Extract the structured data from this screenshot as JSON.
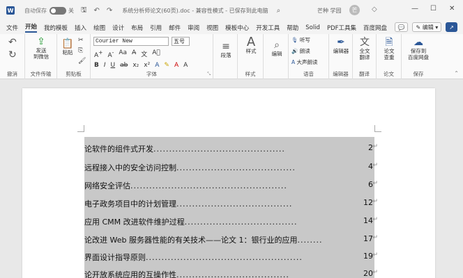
{
  "titlebar": {
    "app_icon": "W",
    "autosave_label": "自动保存",
    "autosave_state": "关",
    "doc_title": "系统分析师论文(60页).doc - 兼容性模式 - 已保存到此电脑",
    "user_name": "芒种 学园",
    "avatar_text": "芒",
    "search_icon": "search-icon",
    "undo_icon": "undo-icon",
    "redo_icon": "redo-icon",
    "save_icon": "save-icon",
    "premium_icon": "diamond-icon",
    "minimize": "—",
    "maximize": "☐",
    "close": "✕"
  },
  "menu": {
    "items": [
      "文件",
      "开始",
      "我的模板",
      "插入",
      "绘图",
      "设计",
      "布局",
      "引用",
      "邮件",
      "审阅",
      "视图",
      "模板中心",
      "开发工具",
      "帮助",
      "Solid",
      "PDF工具集",
      "百度网盘"
    ],
    "active": "开始",
    "comment_label": "💬",
    "edit_label": "编辑",
    "share_label": "↗"
  },
  "ribbon": {
    "undo_group": "撤消",
    "send_label": "发送\n到微信",
    "file_transfer": "文件传输",
    "paste_label": "粘贴",
    "clipboard": "剪贴板",
    "font_name": "Courier New",
    "font_size": "五号",
    "font_group": "字体",
    "paragraph_label": "段落",
    "styles_label": "样式",
    "styles_group": "样式",
    "edit_label": "编辑",
    "dictate_label": "听写",
    "read_label": "朗读",
    "voice_label": "大声朗读",
    "voice_group": "语音",
    "editor_label": "编辑器",
    "editor_group": "编辑器",
    "translate_label": "全文\n翻译",
    "translate_group": "翻译",
    "paper_check_label": "论文\n查重",
    "paper_group": "论文",
    "save_baidu_label": "保存到\n百度网盘",
    "save_group": "保存"
  },
  "document": {
    "toc": [
      {
        "title": "论软件的组件式开发",
        "page": "2"
      },
      {
        "title": "远程接入中的安全访问控制",
        "page": "4"
      },
      {
        "title": "网络安全评估",
        "page": "6"
      },
      {
        "title": "电子政务项目中的计划管理",
        "page": "12"
      },
      {
        "title": "应用 CMM 改进软件维护过程",
        "page": "14"
      },
      {
        "title": "论改进 Web 服务器性能的有关技术——论文 1：银行业的应用",
        "page": "17"
      },
      {
        "title": "界面设计指导原则",
        "page": "19"
      },
      {
        "title": "论开放系统应用的互操作性",
        "page": "20"
      }
    ]
  }
}
